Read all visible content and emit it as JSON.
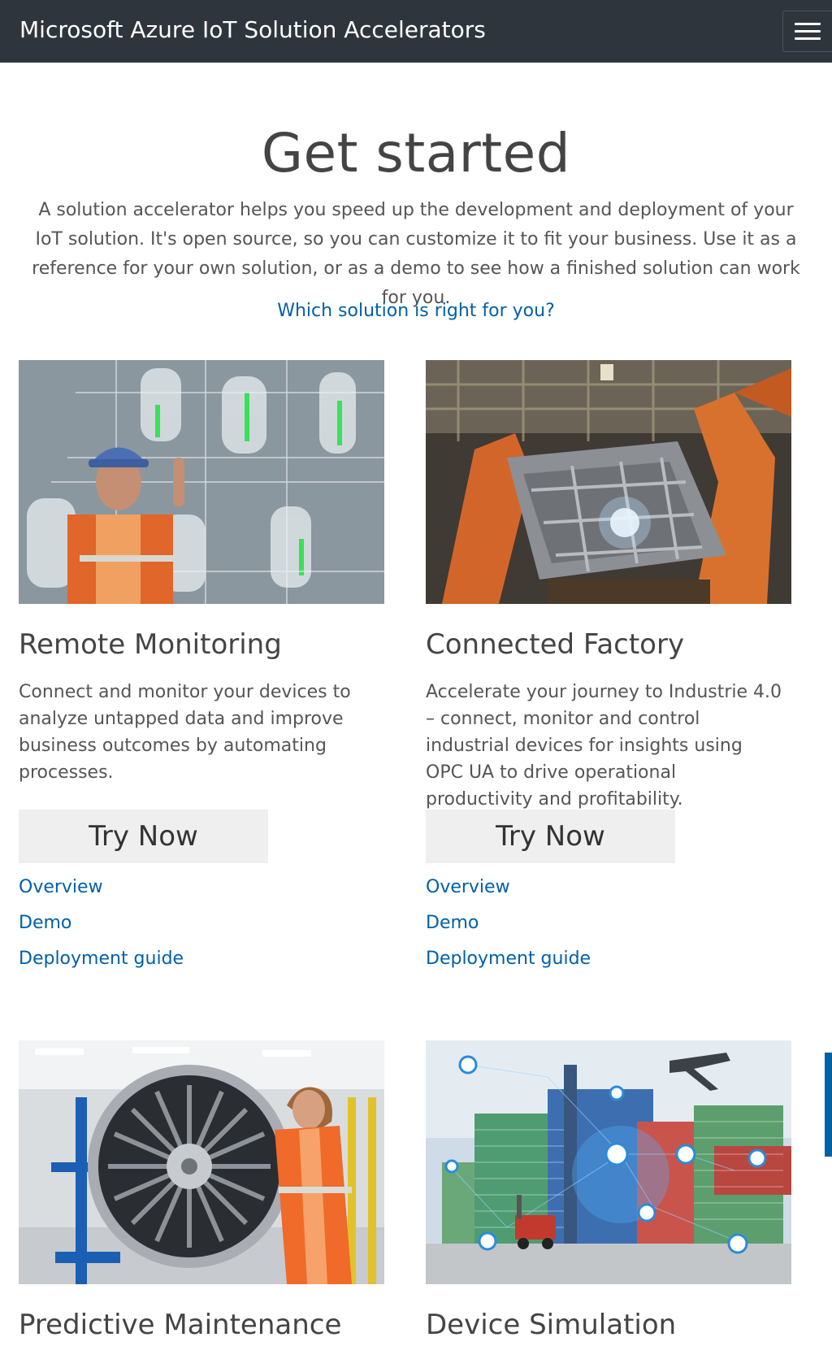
{
  "header": {
    "brand": "Microsoft Azure IoT Solution Accelerators",
    "menu_icon": "hamburger-menu-icon"
  },
  "hero": {
    "title": "Get started",
    "description": "A solution accelerator helps you speed up the development and deployment of your IoT solution. It's open source, so you can customize it to fit your business. Use it as a reference for your own solution, or as a demo to see how a finished solution can work for you.",
    "link": "Which solution is right for you?"
  },
  "cards": [
    {
      "title": "Remote Monitoring",
      "description": "Connect and monitor your devices to analyze untapped data and improve business outcomes by automating processes.",
      "button": "Try Now",
      "links": [
        "Overview",
        "Demo",
        "Deployment guide"
      ]
    },
    {
      "title": "Connected Factory",
      "description": "Accelerate your journey to Industrie 4.0 – connect, monitor and control industrial devices for insights using OPC UA to drive operational productivity and profitability.",
      "button": "Try Now",
      "links": [
        "Overview",
        "Demo",
        "Deployment guide"
      ]
    },
    {
      "title": "Predictive Maintenance"
    },
    {
      "title": "Device Simulation"
    }
  ],
  "colors": {
    "header_bg": "#2f353c",
    "link": "#0060a8",
    "button_bg": "#efefef"
  }
}
